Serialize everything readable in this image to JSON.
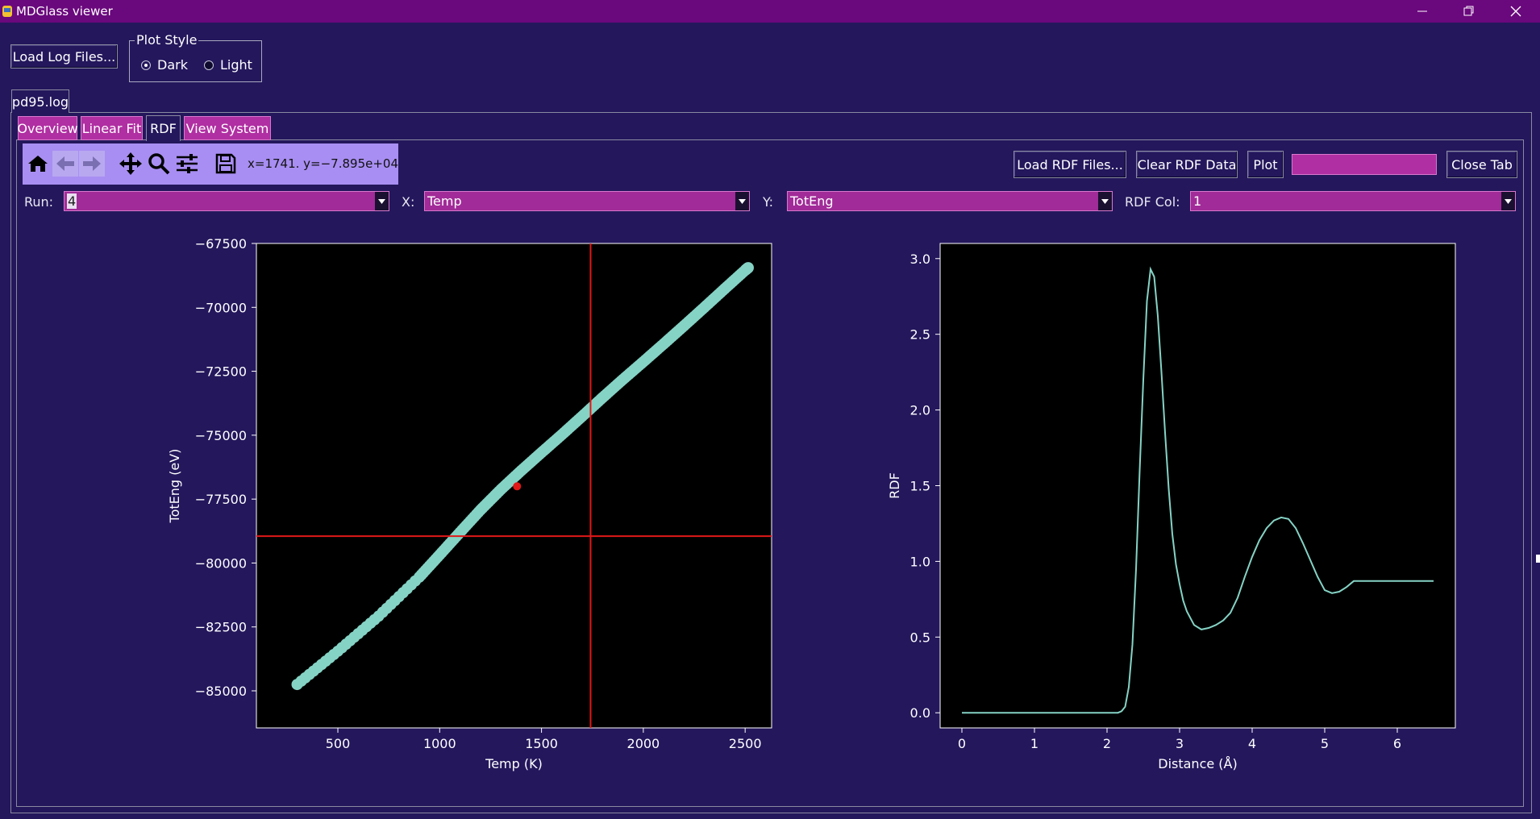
{
  "window": {
    "title": "MDGlass viewer"
  },
  "top": {
    "load_log_label": "Load Log Files...",
    "plot_style": {
      "legend": "Plot Style",
      "dark": "Dark",
      "light": "Light",
      "selected": "Dark"
    }
  },
  "file_tab": {
    "label": "pd95.log"
  },
  "tabs": [
    {
      "label": "Overview",
      "active": false
    },
    {
      "label": "Linear Fit",
      "active": false
    },
    {
      "label": "RDF",
      "active": true
    },
    {
      "label": "View System",
      "active": false
    }
  ],
  "toolbar": {
    "icons": [
      "home-icon",
      "back-arrow-icon",
      "forward-arrow-icon",
      "pan-icon",
      "zoom-icon",
      "configure-icon",
      "save-icon"
    ],
    "coords": "x=1741. y=−7.895e+04"
  },
  "actions": {
    "load_rdf": "Load RDF Files...",
    "clear_rdf": "Clear RDF Data",
    "plot": "Plot",
    "close_tab": "Close Tab"
  },
  "selectors": {
    "run_label": "Run:",
    "run_value": "4",
    "x_label": "X:",
    "x_value": "Temp",
    "y_label": "Y:",
    "y_value": "TotEng",
    "rdf_col_label": "RDF Col:",
    "rdf_col_value": "1"
  },
  "colors": {
    "series": "#85d3c5",
    "crosshair": "#e01818",
    "marker": "#e01818",
    "plot_bg": "#000000"
  },
  "chart_data": [
    {
      "type": "scatter",
      "xlabel": "Temp (K)",
      "ylabel": "TotEng (eV)",
      "xlim": [
        100,
        2630
      ],
      "ylim": [
        -86450,
        -67500
      ],
      "xticks": [
        500,
        1000,
        1500,
        2000,
        2500
      ],
      "yticks": [
        -67500,
        -70000,
        -72500,
        -75000,
        -77500,
        -80000,
        -82500,
        -85000
      ],
      "ytick_labels": [
        "−67500",
        "−70000",
        "−72500",
        "−75000",
        "−77500",
        "−80000",
        "−82500",
        "−85000"
      ],
      "series": [
        {
          "x": [
            300,
            500,
            700,
            900,
            1000,
            1100,
            1200,
            1300,
            1400,
            1500,
            1600,
            1700,
            1800,
            1900,
            2000,
            2100,
            2200,
            2300,
            2400,
            2500,
            2515
          ],
          "values": [
            -84750,
            -83450,
            -82080,
            -80550,
            -79680,
            -78800,
            -77930,
            -77130,
            -76390,
            -75680,
            -74980,
            -74260,
            -73530,
            -72820,
            -72130,
            -71430,
            -70720,
            -70000,
            -69270,
            -68550,
            -68450
          ]
        }
      ],
      "highlight_point": {
        "x": 1380,
        "y": -77000
      },
      "crosshair": {
        "x": 1741,
        "y": -78950
      }
    },
    {
      "type": "line",
      "xlabel": "Distance (Å)",
      "ylabel": "RDF",
      "xlim": [
        -0.3,
        6.8
      ],
      "ylim": [
        -0.1,
        3.1
      ],
      "xticks": [
        0,
        1,
        2,
        3,
        4,
        5,
        6
      ],
      "yticks": [
        0.0,
        0.5,
        1.0,
        1.5,
        2.0,
        2.5,
        3.0
      ],
      "ytick_labels": [
        "0.0",
        "0.5",
        "1.0",
        "1.5",
        "2.0",
        "2.5",
        "3.0"
      ],
      "series": [
        {
          "x": [
            0,
            1,
            2,
            2.15,
            2.2,
            2.25,
            2.3,
            2.35,
            2.4,
            2.45,
            2.5,
            2.55,
            2.6,
            2.65,
            2.7,
            2.75,
            2.8,
            2.85,
            2.9,
            2.95,
            3.0,
            3.05,
            3.1,
            3.2,
            3.3,
            3.4,
            3.5,
            3.6,
            3.7,
            3.8,
            3.9,
            4.0,
            4.1,
            4.2,
            4.3,
            4.4,
            4.5,
            4.6,
            4.7,
            4.8,
            4.9,
            5.0,
            5.1,
            5.2,
            5.3,
            5.4,
            5.5,
            5.6,
            5.7,
            5.8,
            5.9,
            6.0,
            6.1,
            6.2,
            6.3,
            6.4,
            6.5
          ],
          "values": [
            0.0,
            0.0,
            0.0,
            0.0,
            0.01,
            0.04,
            0.17,
            0.45,
            0.95,
            1.6,
            2.2,
            2.72,
            2.93,
            2.88,
            2.62,
            2.25,
            1.85,
            1.48,
            1.18,
            0.98,
            0.85,
            0.74,
            0.67,
            0.58,
            0.55,
            0.56,
            0.58,
            0.61,
            0.66,
            0.76,
            0.9,
            1.03,
            1.14,
            1.22,
            1.27,
            1.29,
            1.28,
            1.22,
            1.12,
            1.01,
            0.9,
            0.81,
            0.79,
            0.8,
            0.83,
            0.87,
            0.87,
            0.87,
            0.87,
            0.87,
            0.87,
            0.87,
            0.87,
            0.87,
            0.87,
            0.87,
            0.87
          ]
        }
      ]
    }
  ]
}
